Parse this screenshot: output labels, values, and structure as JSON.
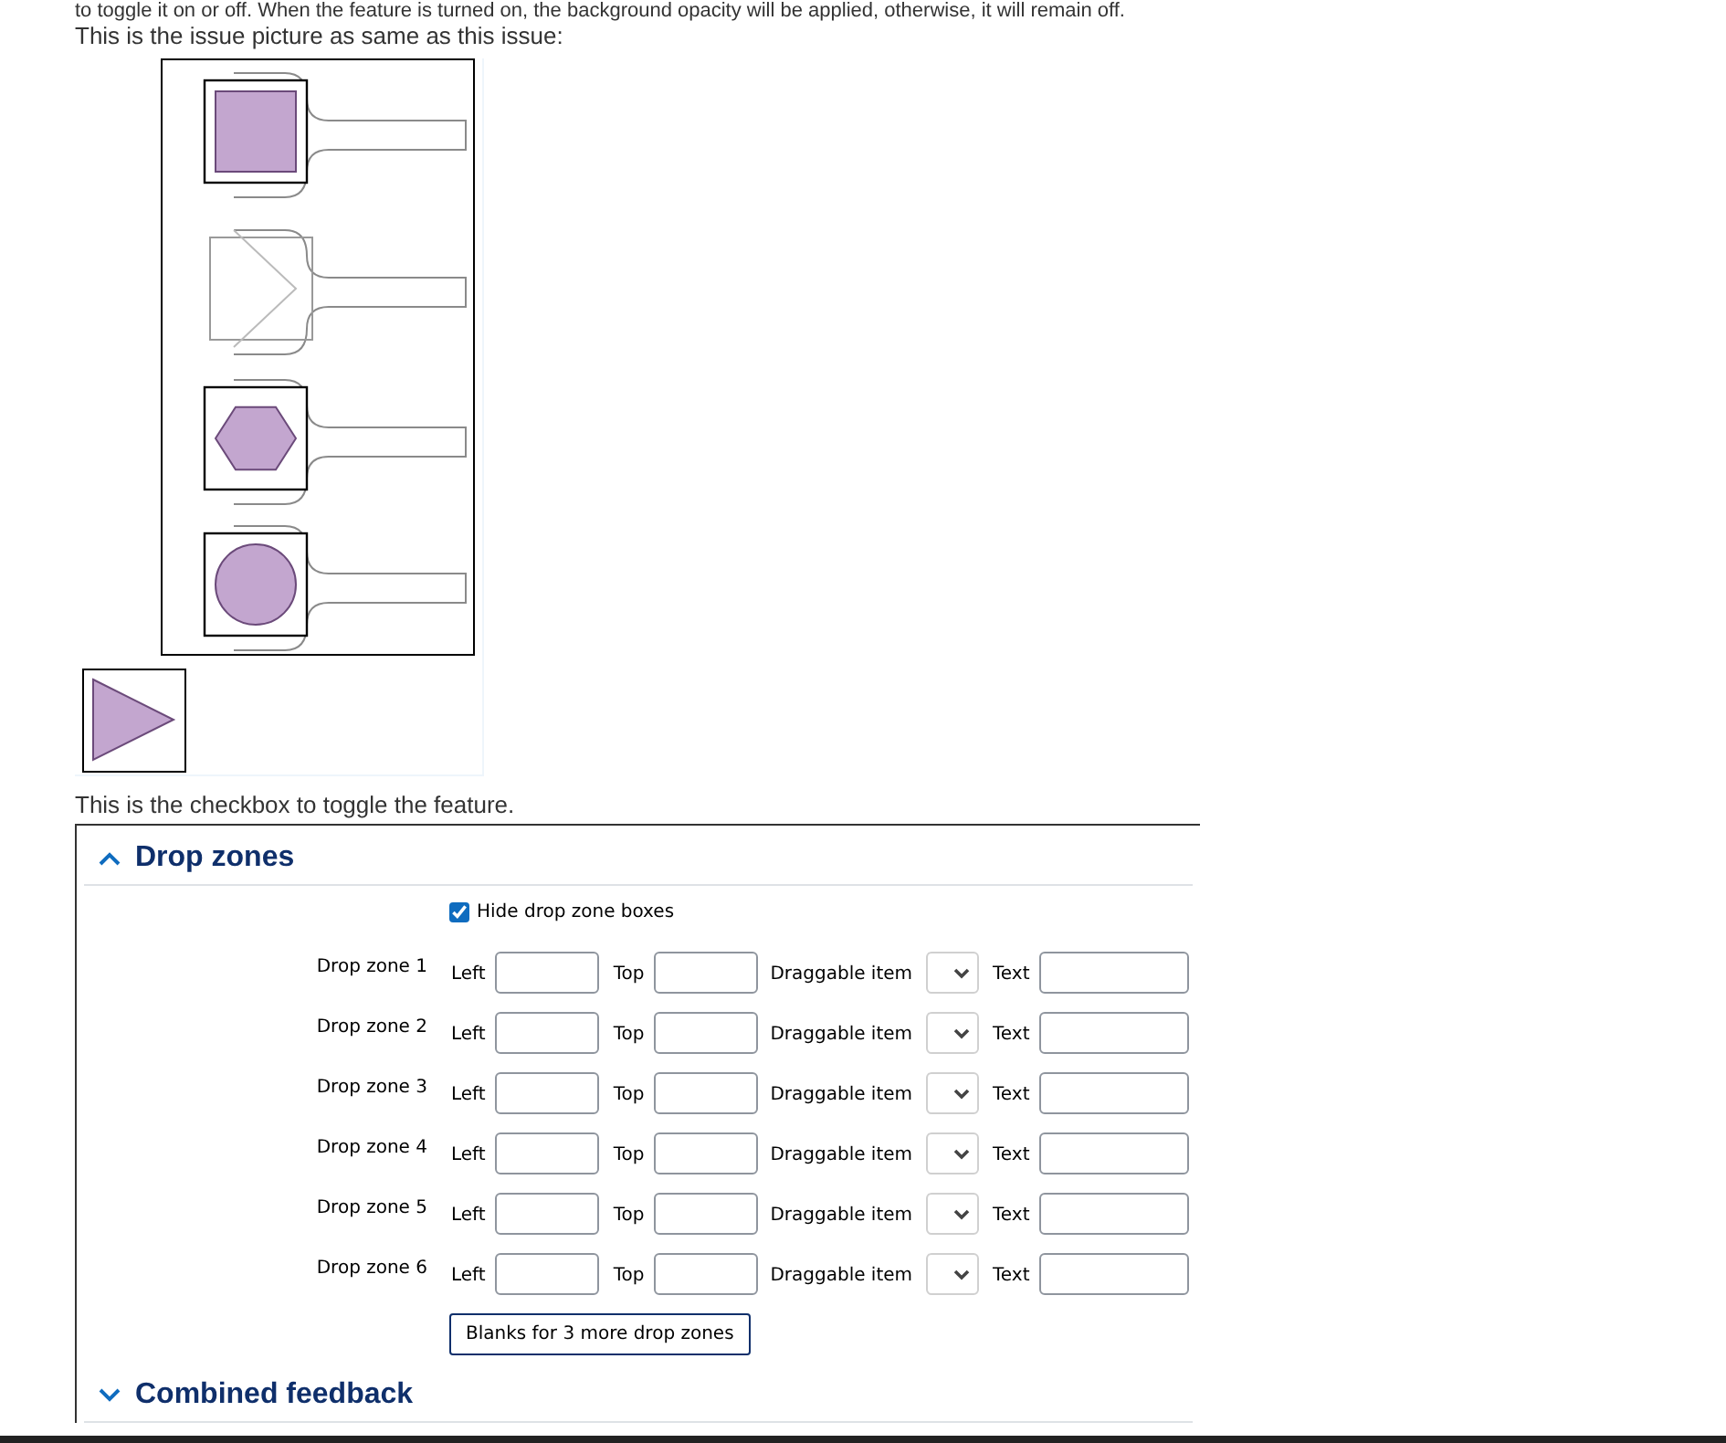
{
  "intro_text": "to toggle it on or off. When the feature is turned on, the background opacity will be applied, otherwise, it will remain off.",
  "picture_caption": "This is the issue picture as same as this issue:",
  "preview": {
    "zones": [
      {
        "kind": "square",
        "placed": true
      },
      {
        "kind": "triangle",
        "placed": false
      },
      {
        "kind": "hexagon",
        "placed": true
      },
      {
        "kind": "circle",
        "placed": true
      }
    ],
    "palette": [
      {
        "kind": "triangle"
      }
    ]
  },
  "checkbox_caption": "This is the checkbox to toggle the feature.",
  "sections": [
    {
      "title": "Drop zones",
      "expanded": true,
      "hide_boxes": {
        "label": "Hide drop zone boxes",
        "checked": true
      },
      "rows": [
        {
          "label": "Drop zone 1",
          "left": "Left",
          "top": "Top",
          "item": "Draggable item",
          "text": "Text"
        },
        {
          "label": "Drop zone 2",
          "left": "Left",
          "top": "Top",
          "item": "Draggable item",
          "text": "Text"
        },
        {
          "label": "Drop zone 3",
          "left": "Left",
          "top": "Top",
          "item": "Draggable item",
          "text": "Text"
        },
        {
          "label": "Drop zone 4",
          "left": "Left",
          "top": "Top",
          "item": "Draggable item",
          "text": "Text"
        },
        {
          "label": "Drop zone 5",
          "left": "Left",
          "top": "Top",
          "item": "Draggable item",
          "text": "Text"
        },
        {
          "label": "Drop zone 6",
          "left": "Left",
          "top": "Top",
          "item": "Draggable item",
          "text": "Text"
        }
      ],
      "add_button": "Blanks for 3 more drop zones"
    },
    {
      "title": "Combined feedback",
      "expanded": false
    }
  ]
}
